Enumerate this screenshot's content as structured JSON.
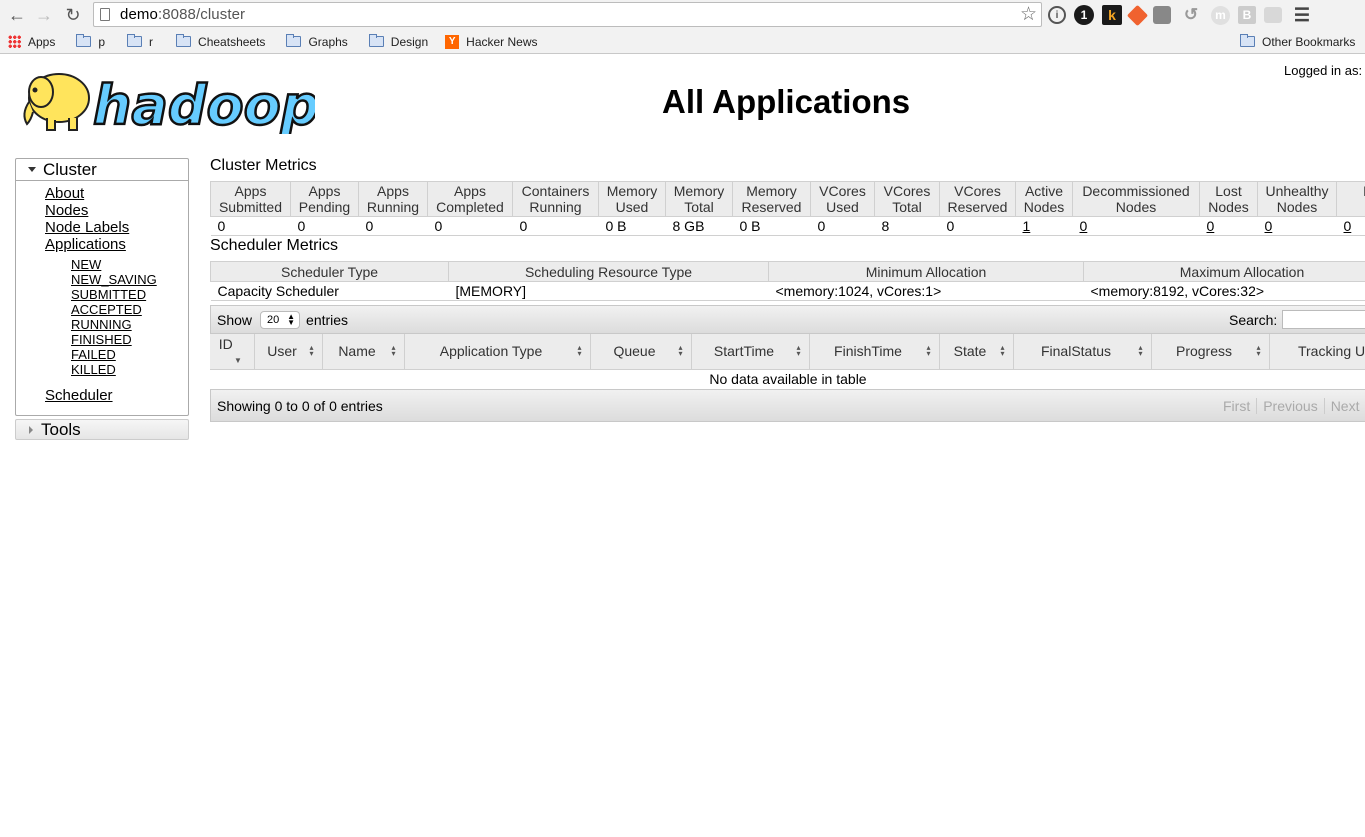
{
  "browser": {
    "url_host": "demo",
    "url_rest": ":8088/cluster",
    "bookmarks": [
      "Apps",
      "p",
      "r",
      "Cheatsheets",
      "Graphs",
      "Design",
      "Hacker News"
    ],
    "other_bookmarks": "Other Bookmarks",
    "extension_labels": [
      "1",
      "k",
      "B"
    ]
  },
  "header": {
    "logo_text": "hadoop",
    "title": "All Applications",
    "logged_in": "Logged in as:"
  },
  "sidebar": {
    "cluster_label": "Cluster",
    "links": [
      "About",
      "Nodes",
      "Node Labels",
      "Applications"
    ],
    "app_states": [
      "NEW",
      "NEW_SAVING",
      "SUBMITTED",
      "ACCEPTED",
      "RUNNING",
      "FINISHED",
      "FAILED",
      "KILLED"
    ],
    "scheduler_label": "Scheduler",
    "tools_label": "Tools"
  },
  "cluster_metrics": {
    "title": "Cluster Metrics",
    "columns": [
      [
        "Apps",
        "Submitted"
      ],
      [
        "Apps",
        "Pending"
      ],
      [
        "Apps",
        "Running"
      ],
      [
        "Apps",
        "Completed"
      ],
      [
        "Containers",
        "Running"
      ],
      [
        "Memory",
        "Used"
      ],
      [
        "Memory",
        "Total"
      ],
      [
        "Memory",
        "Reserved"
      ],
      [
        "VCores",
        "Used"
      ],
      [
        "VCores",
        "Total"
      ],
      [
        "VCores",
        "Reserved"
      ],
      [
        "Active",
        "Nodes"
      ],
      [
        "Decommissioned",
        "Nodes"
      ],
      [
        "Lost",
        "Nodes"
      ],
      [
        "Unhealthy",
        "Nodes"
      ],
      [
        "Rebooted",
        "Nodes"
      ]
    ],
    "values": [
      "0",
      "0",
      "0",
      "0",
      "0",
      "0 B",
      "8 GB",
      "0 B",
      "0",
      "8",
      "0",
      "1",
      "0",
      "0",
      "0",
      "0"
    ]
  },
  "scheduler_metrics": {
    "title": "Scheduler Metrics",
    "columns": [
      "Scheduler Type",
      "Scheduling Resource Type",
      "Minimum Allocation",
      "Maximum Allocation"
    ],
    "values": [
      "Capacity Scheduler",
      "[MEMORY]",
      "<memory:1024, vCores:1>",
      "<memory:8192, vCores:32>"
    ]
  },
  "apps_table": {
    "show_label": "Show",
    "page_length": "20",
    "entries_label": "entries",
    "search_label": "Search:",
    "search_value": "",
    "columns": [
      "ID",
      "User",
      "Name",
      "Application Type",
      "Queue",
      "StartTime",
      "FinishTime",
      "State",
      "FinalStatus",
      "Progress",
      "Tracking UI"
    ],
    "empty_message": "No data available in table",
    "info": "Showing 0 to 0 of 0 entries",
    "pager": [
      "First",
      "Previous",
      "Next"
    ]
  },
  "colors": {
    "header_bg": "#ececec",
    "border": "#d0d0d0",
    "logo_yellow": "#ffe45c",
    "logo_blue": "#66ccff"
  }
}
